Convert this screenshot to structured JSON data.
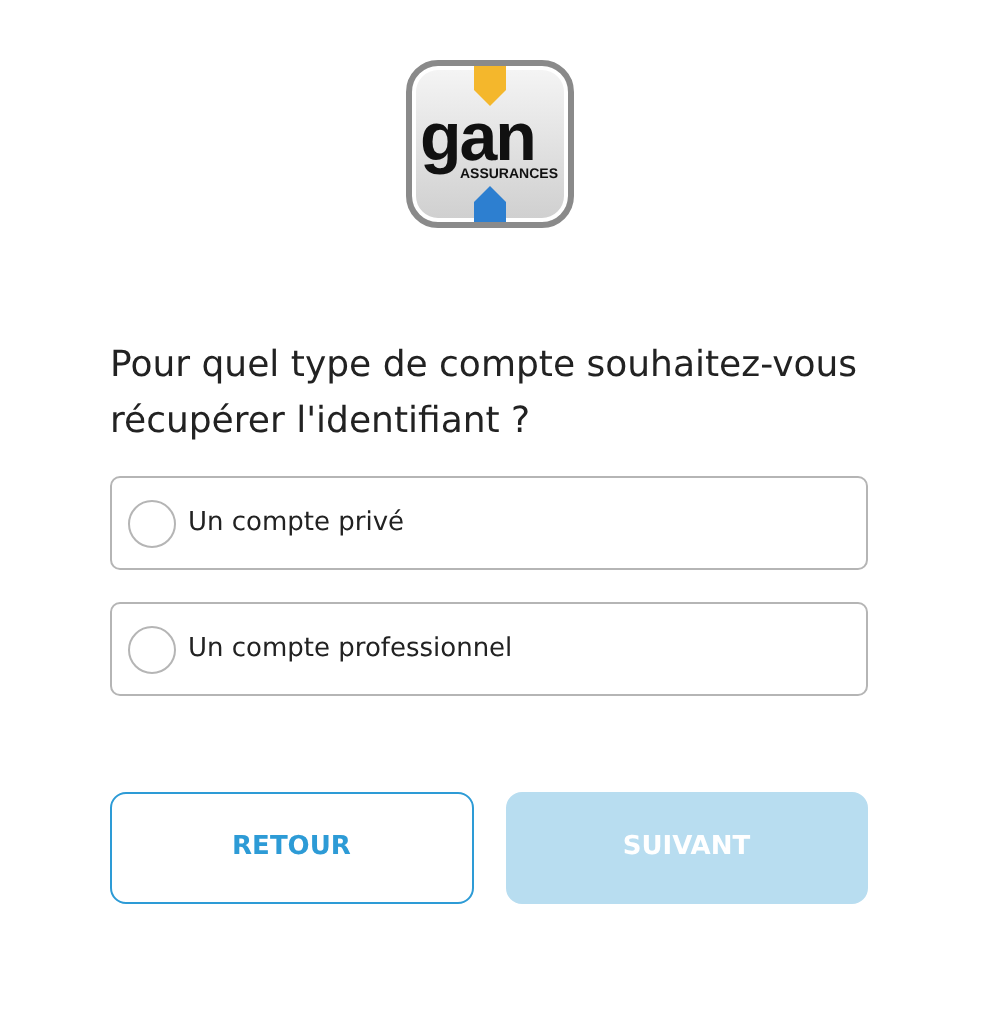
{
  "logo": {
    "wordmark": "gan",
    "tagline": "ASSURANCES"
  },
  "question": "Pour quel type de compte souhaitez-vous récupérer l'identifiant ?",
  "options": [
    {
      "label": "Un compte privé",
      "selected": false
    },
    {
      "label": "Un compte professionnel",
      "selected": false
    }
  ],
  "buttons": [
    {
      "label": "RETOUR",
      "kind": "secondary",
      "disabled": false
    },
    {
      "label": "SUIVANT",
      "kind": "primary",
      "disabled": true
    }
  ]
}
